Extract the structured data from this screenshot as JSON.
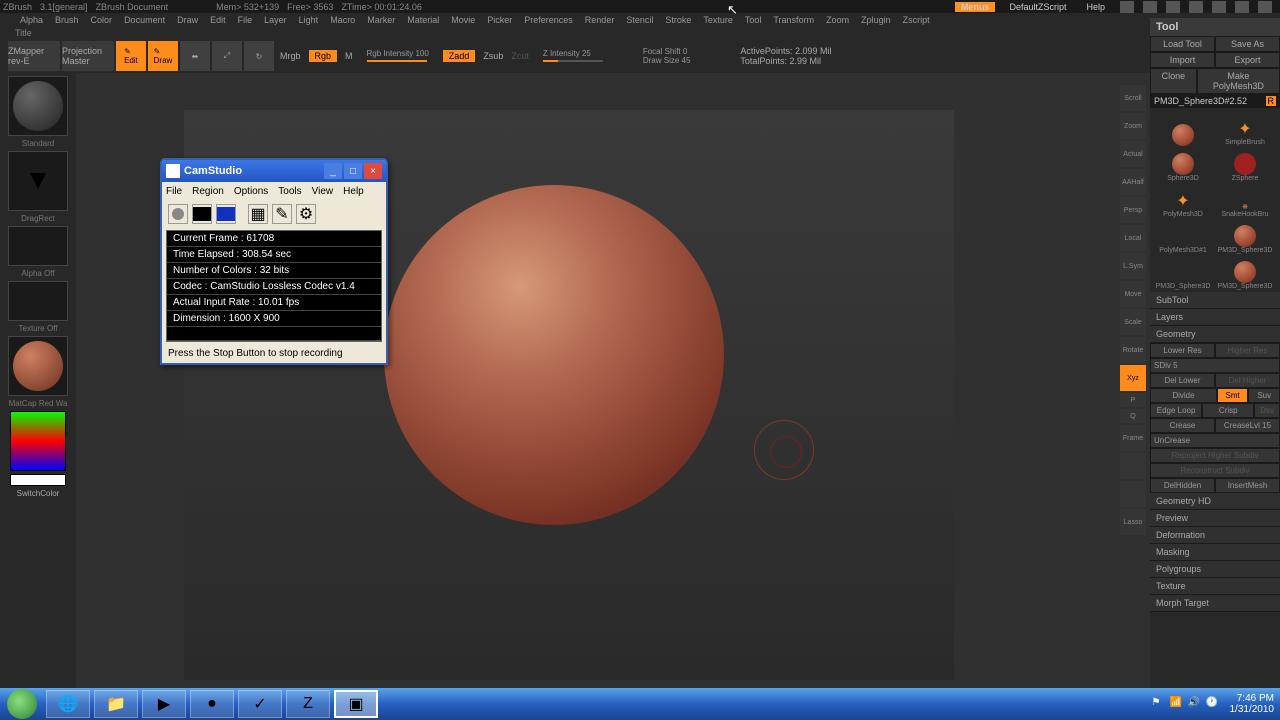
{
  "app": {
    "name": "ZBrush",
    "version": "3.1[general]",
    "doc": "ZBrush Document",
    "mem": "Mem> 532+139",
    "free": "Free> 3563",
    "ztime": "ZTime> 00:01:24.06"
  },
  "titlebar_right": {
    "menus": "Menus",
    "script": "DefaultZScript",
    "help": "Help"
  },
  "menubar": [
    "Alpha",
    "Brush",
    "Color",
    "Document",
    "Draw",
    "Edit",
    "File",
    "Layer",
    "Light",
    "Macro",
    "Marker",
    "Material",
    "Movie",
    "Picker",
    "Preferences",
    "Render",
    "Stencil",
    "Stroke",
    "Texture",
    "Tool",
    "Transform",
    "Zoom",
    "Zplugin",
    "Zscript"
  ],
  "titlerow": "Title",
  "toolbar": {
    "zmapper": "ZMapper\nrev-E",
    "projection": "Projection\nMaster",
    "mrgb": "Mrgb",
    "rgb": "Rgb",
    "m": "M",
    "rgb_intensity": "Rgb Intensity 100",
    "zadd": "Zadd",
    "zsub": "Zsub",
    "zcut": "Zcut",
    "z_intensity": "Z Intensity 25",
    "focal_shift": "Focal Shift 0",
    "draw_size": "Draw Size 45",
    "active_points": "ActivePoints: 2.099 Mil",
    "total_points": "TotalPoints: 2.99 Mil"
  },
  "leftbar": {
    "standard": "Standard",
    "dragrect": "DragRect",
    "alpha_off": "Alpha Off",
    "texture_off": "Texture Off",
    "matcap": "MatCap Red Wa",
    "switchcolor": "SwitchColor"
  },
  "right_icons": [
    "Scroll",
    "Zoom",
    "Actual",
    "AAHalf",
    "Persp",
    "Local",
    "L.Sym",
    "Move",
    "Scale",
    "Rotate",
    "Xyz",
    "P",
    "Q",
    "Frame",
    "?",
    "?",
    "Lasso"
  ],
  "toolpanel": {
    "title": "Tool",
    "load": "Load Tool",
    "saveas": "Save As",
    "import": "Import",
    "export": "Export",
    "clone": "Clone",
    "makepoly": "Make PolyMesh3D",
    "toolname": "PM3D_Sphere3D#2.52",
    "tools": [
      "SimpleBrush",
      "Sphere3D",
      "ZSphere",
      "PolyMesh3D",
      "SnakeHookBru",
      "PolyMesh3D#1",
      "PM3D_Sphere3D",
      "PM3D_Sphere3D",
      "PM3D_Sphere3D"
    ],
    "sections": {
      "subtool": "SubTool",
      "layers": "Layers",
      "geometry": "Geometry",
      "lower_res": "Lower Res",
      "higher_res": "Higher Res",
      "sdiv": "SDiv 5",
      "del_lower": "Del Lower",
      "del_higher": "Del Higher",
      "divide": "Divide",
      "smt": "Smt",
      "suv": "Suv",
      "edge_loop": "Edge Loop",
      "crisp": "Crisp",
      "dsv": "Dsv",
      "crease": "Crease",
      "creaselvl": "CreaseLvl 15",
      "uncrease": "UnCrease",
      "reproject": "Reproject Higher Subdiv",
      "reconstruct": "Reconstruct Subdiv",
      "delhidden": "DelHidden",
      "insertmesh": "InsertMesh",
      "geometry_hd": "Geometry HD",
      "preview": "Preview",
      "deformation": "Deformation",
      "masking": "Masking",
      "polygroups": "Polygroups",
      "texture": "Texture",
      "morph_target": "Morph Target"
    }
  },
  "camstudio": {
    "title": "CamStudio",
    "menu": [
      "File",
      "Region",
      "Options",
      "Tools",
      "View",
      "Help"
    ],
    "info": {
      "frame": "Current Frame : 61708",
      "elapsed": "Time Elapsed : 308.54 sec",
      "colors": "Number of Colors : 32 bits",
      "codec": "Codec : CamStudio Lossless Codec v1.4",
      "rate": "Actual Input Rate : 10.01 fps",
      "dimension": "Dimension : 1600 X 900"
    },
    "status": "Press the Stop Button to stop recording"
  },
  "taskbar": {
    "time": "7:46 PM",
    "date": "1/31/2010"
  }
}
